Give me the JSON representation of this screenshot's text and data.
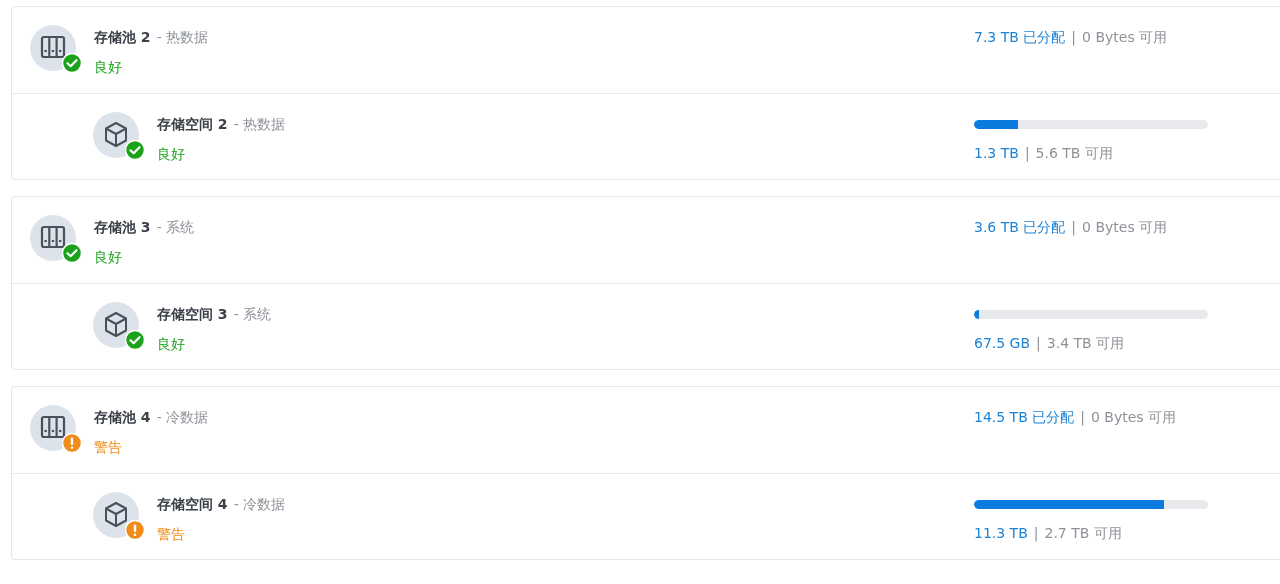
{
  "pools": [
    {
      "name": "存储池 2",
      "tag": "- 热数据",
      "kind": "good",
      "status_text": "良好",
      "allocated": "7.3 TB 已分配",
      "separator": "|",
      "free": "0 Bytes 可用",
      "volume": {
        "name": "存储空间 2",
        "tag": "- 热数据",
        "kind": "good",
        "status_text": "良好",
        "level": 0.19,
        "used": "1.3 TB",
        "separator": "|",
        "free": "5.6 TB 可用"
      }
    },
    {
      "name": "存储池 3",
      "tag": "- 系统",
      "kind": "good",
      "status_text": "良好",
      "allocated": "3.6 TB 已分配",
      "separator": "|",
      "free": "0 Bytes 可用",
      "volume": {
        "name": "存储空间 3",
        "tag": "- 系统",
        "kind": "good",
        "status_text": "良好",
        "level": 0.02,
        "used": "67.5 GB",
        "separator": "|",
        "free": "3.4 TB 可用"
      }
    },
    {
      "name": "存储池 4",
      "tag": "- 冷数据",
      "kind": "warning",
      "status_text": "警告",
      "allocated": "14.5 TB 已分配",
      "separator": "|",
      "free": "0 Bytes 可用",
      "volume": {
        "name": "存储空间 4",
        "tag": "- 冷数据",
        "kind": "warning",
        "status_text": "警告",
        "level": 0.81,
        "used": "11.3 TB",
        "separator": "|",
        "free": "2.7 TB 可用"
      }
    }
  ]
}
